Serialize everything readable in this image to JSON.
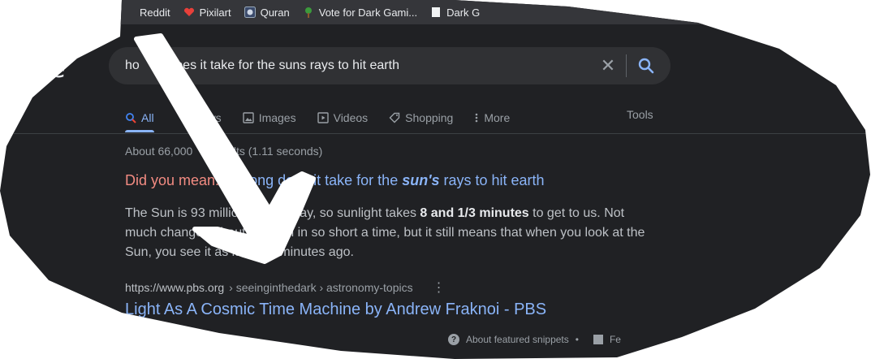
{
  "bookmarks": [
    {
      "label": "Reddit",
      "icon": "reddit-icon"
    },
    {
      "label": "Pixilart",
      "icon": "heart-icon"
    },
    {
      "label": "Quran",
      "icon": "quran-icon"
    },
    {
      "label": "Vote for Dark Gami...",
      "icon": "tree-icon"
    },
    {
      "label": "Dark G",
      "icon": "page-icon"
    }
  ],
  "logo_fragment": "e",
  "search": {
    "value": "how long does it take for the suns rays to hit earth",
    "visible_value": "ho     g does it take for the suns rays to hit earth"
  },
  "tabs": [
    {
      "label": "All",
      "icon": "search-icon",
      "active": true
    },
    {
      "label": "News",
      "visible_label": "ws",
      "icon": "news-icon",
      "active": false
    },
    {
      "label": "Images",
      "icon": "image-icon",
      "active": false
    },
    {
      "label": "Videos",
      "icon": "play-icon",
      "active": false
    },
    {
      "label": "Shopping",
      "icon": "tag-icon",
      "active": false
    },
    {
      "label": "More",
      "icon": "more-vert-icon",
      "active": false
    }
  ],
  "tools_label": "Tools",
  "stats_text": "About 66,000      results (1.11 seconds)",
  "did_you_mean": {
    "label": "Did you mean:",
    "link_prefix": "  w long does it take for the ",
    "link_bold": "sun's",
    "link_suffix": " rays to hit earth"
  },
  "snippet": {
    "part1": "The Sun is 93 million miles away, so sunlight takes ",
    "bold": "8 and 1/3 minutes",
    "part2": " to get to us. Not much changes about the Sun in so short a time, but it still means that when you look at the Sun, you see it as it was 8 minutes ago."
  },
  "citation": {
    "domain": "https://www.pbs.org",
    "path": "› seeinginthedark › astronomy-topics"
  },
  "result_title": "Light As A Cosmic Time Machine by Andrew Fraknoi - PBS",
  "footer": {
    "about": "About featured snippets",
    "dot": "•",
    "feedback": "Fe"
  },
  "colors": {
    "background": "#202124",
    "link": "#8ab4f8",
    "did_you_mean": "#f28b82",
    "annotation": "#ffffff"
  }
}
